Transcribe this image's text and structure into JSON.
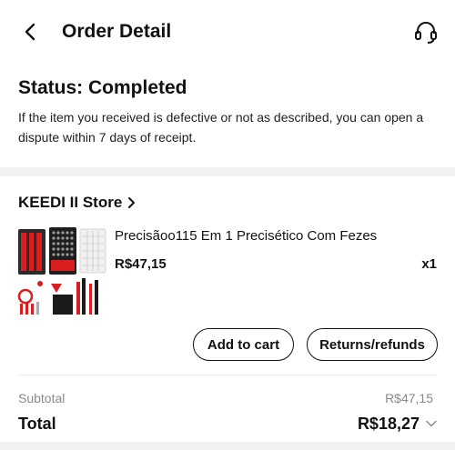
{
  "header": {
    "title": "Order Detail",
    "back_icon": "chevron-left-icon",
    "support_icon": "headset-icon"
  },
  "status": {
    "title": "Status: Completed",
    "description": "If the item you received is defective or not as described, you can open a dispute within 7 days of receipt."
  },
  "store": {
    "name": "KEEDI II Store",
    "chevron_icon": "chevron-right-icon"
  },
  "product": {
    "name": "Precisãoo115 Em 1 Precisético Com Fezes",
    "price": "R$47,15",
    "quantity": "x1",
    "image_icon": "screwdriver-kit-image"
  },
  "actions": {
    "add_to_cart": "Add to cart",
    "returns_refunds": "Returns/refunds"
  },
  "summary": {
    "subtotal_label": "Subtotal",
    "subtotal_value": "R$47,15",
    "total_label": "Total",
    "total_value": "R$18,27",
    "expand_icon": "chevron-down-icon"
  },
  "colors": {
    "accent_red": "#d81e1e",
    "text_primary": "#111111",
    "text_muted": "#8a8a8a",
    "band_gray": "#f2f2f2"
  }
}
